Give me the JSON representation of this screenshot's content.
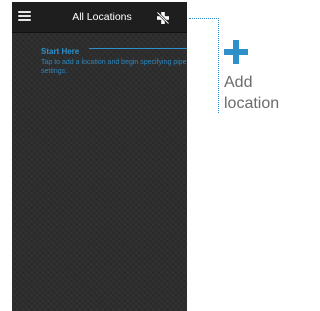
{
  "header": {
    "title": "All Locations",
    "menu_icon": "hamburger-menu-icon",
    "action_icon": "add-location-disabled-icon"
  },
  "hint": {
    "title": "Start Here",
    "body": "Tap to add a location and begin specifying pipe settings."
  },
  "callout": {
    "icon": "plus-icon",
    "label": "Add location"
  },
  "colors": {
    "accent": "#2f8fc8",
    "background": "#2b2b2b",
    "header": "#1e1e1e",
    "callout_text": "#6b6b6b"
  }
}
